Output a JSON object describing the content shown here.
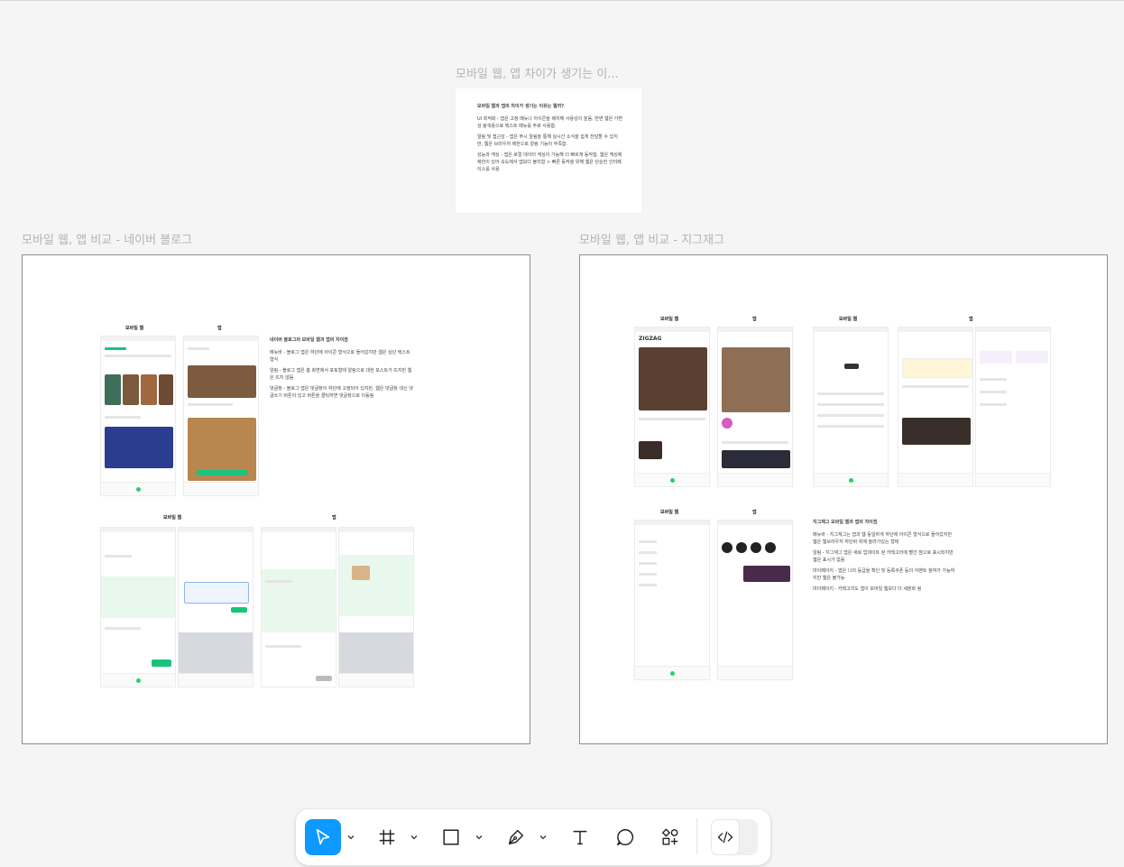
{
  "canvas": {
    "top_card": {
      "label": "모바일 웹, 앱 차이가 생기는 이...",
      "heading": "모바일 웹과 앱의 차이가 생기는 이유는 뭘까?",
      "paragraphs": [
        "UI 최적화 - 앱은 고정 메뉴나 아이콘을 배치해 사용성이 높음, 반면 웹은 가변성 탐색용으로 텍스트 메뉴를 주로 사용함.",
        "알림 및 접근성 - 앱은 푸시 알림을 통해 실시간 소식을 쉽게 전달할 수 있지만, 웹은 브라우저 제한으로 알림 기능이 부족함.",
        "성능과 캐싱 - 앱은 로컬 데이터 캐싱이 가능해 더 빠르게 동작함. 웹은 캐싱에 제한이 있어 속도에서 앱보다 불리함 > 빠른 동작을 위해 웹은 단순한 인터페이스를 사용"
      ]
    },
    "naver_frame": {
      "label": "모바일 웹, 앱 비교 - 네이버 블로그",
      "col_mobile_web": "모바일 웹",
      "col_app": "앱",
      "col_mobile_web_2": "모바일 웹",
      "col_app_2": "앱",
      "note_heading": "네이버 블로그의 모바일 웹과 앱의 차이점",
      "note_paragraphs": [
        "메뉴바 - 블로그 앱은 하단에 아이콘 형식으로 들어갔지만 웹은 상단 텍스트 형식",
        "알림 - 블로그 앱은 홈 화면에서 포토형태 알림으로 대한 포스트가 뜨지만 웹은 뜨지 않음",
        "댓글창 - 블로그 앱은 댓글창이 하단에 고정되어 있지만, 웹은 댓글창 대신 댓글쓰기 버튼이 있고 버튼을 클릭하면 댓글창으로 이동됨"
      ]
    },
    "zigzag_frame": {
      "label": "모바일 웹, 앱 비교 - 지그재그",
      "col_mobile_web": "모바일 웹",
      "col_app": "앱",
      "col_mobile_web_2": "모바일 웹",
      "col_app_2": "앱",
      "col_mobile_web_3": "모바일 웹",
      "col_app_3": "앱",
      "brand": "ZIGZAG",
      "note_heading": "지그재그 모바일 웹과 앱의 차이점",
      "note_paragraphs": [
        "메뉴바 - 지그재그는 앱과 웹 동일하게 하단에 아이콘 형식으로 들어갔지만 웹은 웹브라우저 하단바 위에 올라가있는 형태",
        "알림 - 지그재그 앱은 새로 업데이트 된 카테고리에 빨간 점으로 표시되지만 웹은 표시가 없음",
        "마이페이지 - 앱은 나의 등급을 확인 및 등록쿠폰 등의 이벤트 참여가 가능하지만 웹은 불가능",
        "마이페이지 - 카테고리도 앱이 모바일 웹보다 더 세분화 됨"
      ]
    }
  },
  "toolbar": {
    "tools": [
      {
        "name": "move",
        "icon": "cursor-arrow-icon",
        "active": true
      },
      {
        "name": "frame",
        "icon": "frame-hash-icon",
        "active": false
      },
      {
        "name": "rectangle",
        "icon": "rectangle-icon",
        "active": false
      },
      {
        "name": "pen",
        "icon": "pen-icon",
        "active": false
      },
      {
        "name": "text",
        "icon": "text-icon",
        "active": false
      },
      {
        "name": "comment",
        "icon": "comment-icon",
        "active": false
      },
      {
        "name": "actions",
        "icon": "shapes-plus-icon",
        "active": false
      },
      {
        "name": "dev-mode",
        "icon": "code-brackets-icon",
        "active": false
      }
    ],
    "accent_color": "#0d99ff"
  }
}
